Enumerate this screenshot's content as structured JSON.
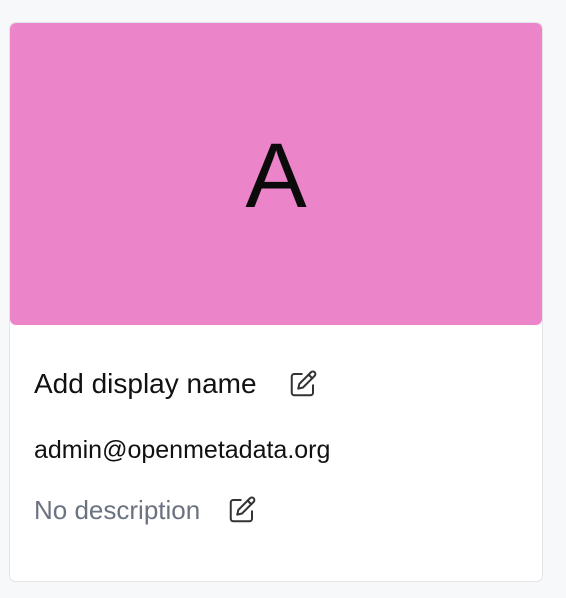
{
  "profile": {
    "avatar_letter": "A",
    "avatar_color": "#ec84c9",
    "display_name_placeholder": "Add display name",
    "email": "admin@openmetadata.org",
    "description_placeholder": "No description"
  },
  "icons": {
    "edit_name": "edit-icon",
    "edit_description": "edit-icon"
  }
}
